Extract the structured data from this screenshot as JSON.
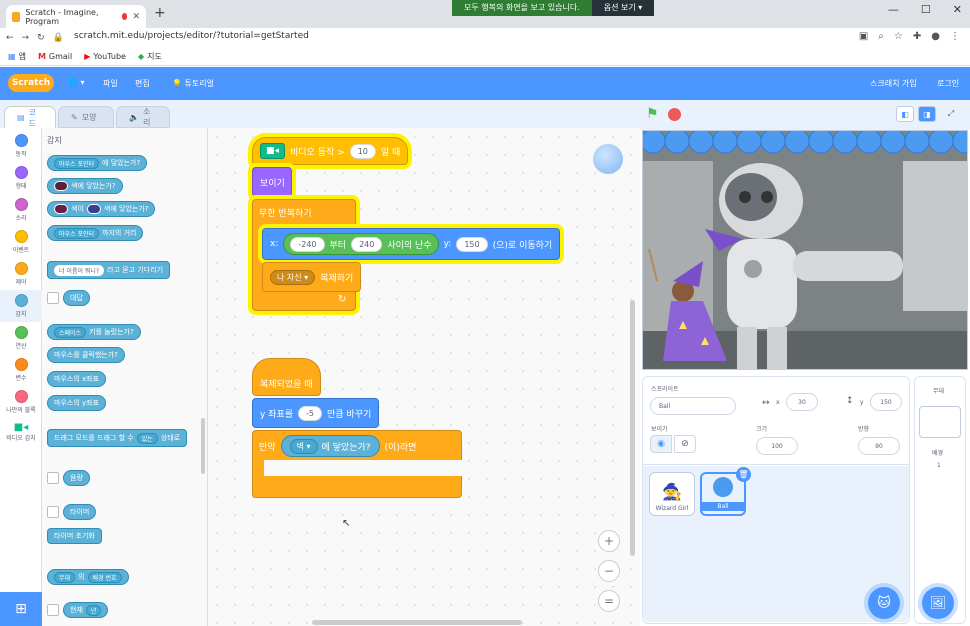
{
  "browser": {
    "tab_title": "Scratch - Imagine, Program",
    "url": "scratch.mit.edu/projects/editor/?tutorial=getStarted",
    "share_message": "모두 행복의 화면을 보고 있습니다.",
    "share_option": "옵션 보기",
    "bookmarks": [
      "앱",
      "Gmail",
      "YouTube",
      "지도"
    ]
  },
  "menu": {
    "logo": "Scratch",
    "file": "파일",
    "edit": "편집",
    "tutorials": "튜토리얼",
    "join": "스크래치 가입",
    "login": "로그인"
  },
  "editor_tabs": {
    "code": "코드",
    "costumes": "모양",
    "sounds": "소리"
  },
  "categories": [
    {
      "label": "동작",
      "color": "#4c97ff"
    },
    {
      "label": "형태",
      "color": "#9966ff"
    },
    {
      "label": "소리",
      "color": "#cf63cf"
    },
    {
      "label": "이벤트",
      "color": "#ffbf00"
    },
    {
      "label": "제어",
      "color": "#ffab19"
    },
    {
      "label": "감지",
      "color": "#5cb1d6"
    },
    {
      "label": "연산",
      "color": "#59c059"
    },
    {
      "label": "변수",
      "color": "#ff8c1a"
    },
    {
      "label": "나만의 블록",
      "color": "#ff6680"
    },
    {
      "label": "비디오 감지",
      "color": "#0fbd8c"
    }
  ],
  "palette": {
    "heading": "감지",
    "touching_mouse": {
      "dd": "마우스 포인터",
      "text": "에 닿았는가?"
    },
    "touching_color": "색에 닿았는가?",
    "color_touching": {
      "a": "색이",
      "b": "색에 닿았는가?"
    },
    "distance": {
      "dd": "마우스 포인터",
      "text": "까지의 거리"
    },
    "ask": {
      "slot": "너 이름이 뭐니?",
      "text": "라고 묻고 기다리기"
    },
    "answer": "대답",
    "key_pressed": {
      "dd": "스페이스",
      "text": "키를 눌렀는가?"
    },
    "mouse_down": "마우스를 클릭했는가?",
    "mouse_x": "마우스의 x좌표",
    "mouse_y": "마우스의 y좌표",
    "drag_mode": {
      "text": "드래그 모드를 드래그 할 수",
      "dd": "있는",
      "text2": "상태로"
    },
    "loudness": "음량",
    "timer": "타이머",
    "reset_timer": "타이머 초기화",
    "backdrop_of": {
      "dd1": "무대",
      "of": "의",
      "dd2": "배경 번호"
    },
    "current": {
      "text": "현재",
      "dd": "년"
    }
  },
  "script1": {
    "hat": {
      "text": "비디오 동작 >",
      "value": "10",
      "suffix": "일 때"
    },
    "show": "보이기",
    "forever": "무한 반복하기",
    "goto": {
      "x": "x:",
      "from": "-240",
      "mid": "부터",
      "to": "240",
      "tail": "사이의 난수",
      "y": "y:",
      "yval": "150",
      "suffix": "(으)로 이동하기"
    },
    "clone": {
      "dd": "나 자신",
      "text": "복제하기"
    }
  },
  "script2": {
    "hat": "복제되었을 때",
    "change_y": {
      "text": "y 좌표를",
      "value": "-5",
      "suffix": "만큼 바꾸기"
    },
    "if": {
      "text": "만약",
      "dd": "벽",
      "cond": "에 닿았는가?",
      "then": "(이)라면"
    }
  },
  "zoom": {
    "in": "+",
    "out": "−",
    "reset": "="
  },
  "sprite_info": {
    "sprite_label": "스프라이트",
    "name": "Ball",
    "x_label": "x",
    "x": "30",
    "y_label": "y",
    "y": "150",
    "show_label": "보이기",
    "size_label": "크기",
    "size": "100",
    "direction_label": "방향",
    "direction": "90"
  },
  "sprites": [
    {
      "name": "Wizard Girl",
      "selected": false
    },
    {
      "name": "Ball",
      "selected": true
    }
  ],
  "stage_pane": {
    "label": "무대",
    "backdrops_label": "배경",
    "backdrops_count": "1"
  }
}
